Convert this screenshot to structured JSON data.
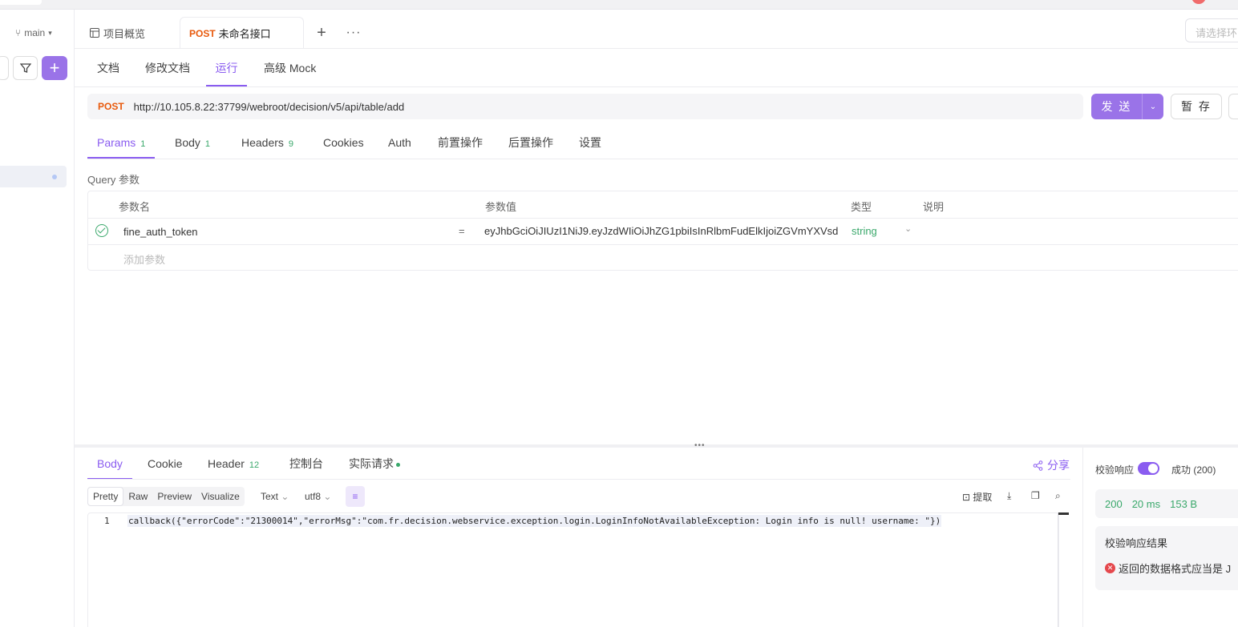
{
  "sidebar": {
    "branch": "main"
  },
  "tabs": {
    "overview": "项目概览",
    "active_method": "POST",
    "active_name": "未命名接口",
    "plus": "+",
    "more": "···"
  },
  "env": {
    "placeholder": "请选择环"
  },
  "subtabs": [
    "文档",
    "修改文档",
    "运行",
    "高级 Mock"
  ],
  "request": {
    "method": "POST",
    "url": "http://10.105.8.22:37799/webroot/decision/v5/api/table/add",
    "send": "发 送",
    "save": "暂 存"
  },
  "param_tabs": [
    {
      "label": "Params",
      "count": "1"
    },
    {
      "label": "Body",
      "count": "1"
    },
    {
      "label": "Headers",
      "count": "9"
    },
    {
      "label": "Cookies",
      "count": ""
    },
    {
      "label": "Auth",
      "count": ""
    },
    {
      "label": "前置操作",
      "count": ""
    },
    {
      "label": "后置操作",
      "count": ""
    },
    {
      "label": "设置",
      "count": ""
    }
  ],
  "query": {
    "label": "Query 参数",
    "headers": {
      "name": "参数名",
      "value": "参数值",
      "type": "类型",
      "desc": "说明"
    },
    "rows": [
      {
        "name": "fine_auth_token",
        "eq": "=",
        "value": "eyJhbGciOiJIUzI1NiJ9.eyJzdWIiOiJhZG1pbiIsInRlbmFudElkIjoiZGVmYXVsd",
        "type": "string"
      }
    ],
    "add_placeholder": "添加参数"
  },
  "response": {
    "tabs": [
      {
        "label": "Body",
        "count": ""
      },
      {
        "label": "Cookie",
        "count": ""
      },
      {
        "label": "Header",
        "count": "12"
      },
      {
        "label": "控制台",
        "count": ""
      },
      {
        "label": "实际请求",
        "count": ""
      }
    ],
    "share": "分享",
    "formats": [
      "Pretty",
      "Raw",
      "Preview",
      "Visualize"
    ],
    "text_type": "Text",
    "encoding": "utf8",
    "extract": "提取",
    "line_no": "1",
    "body": "callback({\"errorCode\":\"21300014\",\"errorMsg\":\"com.fr.decision.webservice.exception.login.LoginInfoNotAvailableException: Login info is null! username: \"})"
  },
  "validate": {
    "label": "校验响应",
    "status": "成功 (200)",
    "code": "200",
    "time": "20 ms",
    "size": "153 B",
    "result_title": "校验响应结果",
    "error": "返回的数据格式应当是 J"
  }
}
